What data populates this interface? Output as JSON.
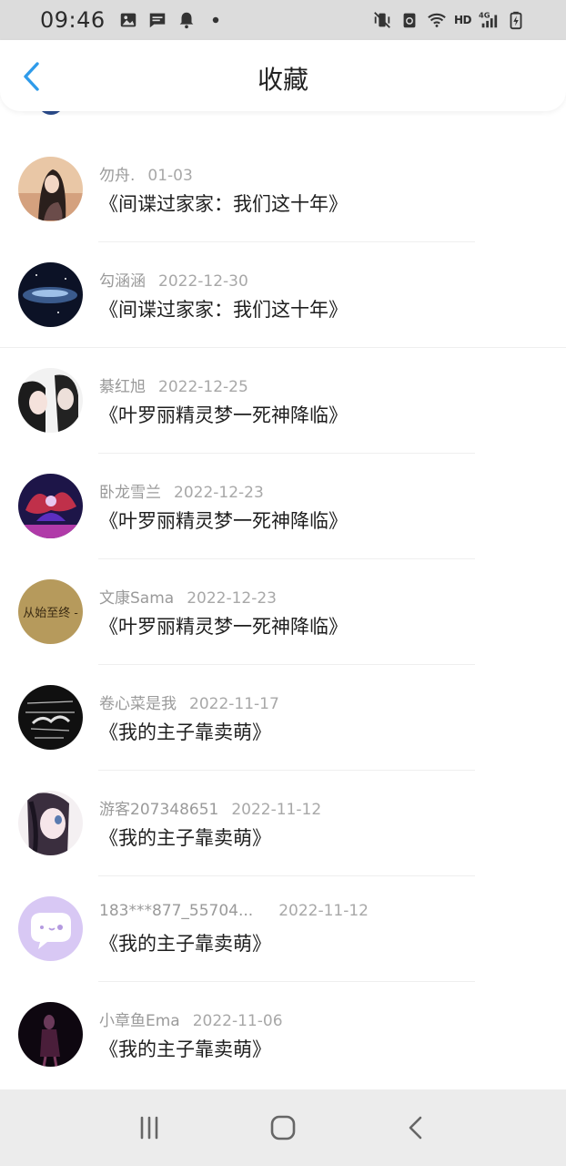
{
  "status_bar": {
    "time": "09:46",
    "network": "HD",
    "network_gen": "4G"
  },
  "header": {
    "title": "收藏",
    "back_icon": "chevron-left-icon"
  },
  "favorites": [
    {
      "user": "勿舟.",
      "date": "01-03",
      "book": "《间谍过家家：我们这十年》",
      "avatar_color": "#c9a58a"
    },
    {
      "user": "勾涵涵",
      "date": "2022-12-30",
      "book": "《间谍过家家：我们这十年》",
      "avatar_color": "#1d2a44"
    },
    {
      "user": "綦红旭",
      "date": "2022-12-25",
      "book": "《叶罗丽精灵梦一死神降临》",
      "avatar_color": "#d9d9d9"
    },
    {
      "user": "卧龙雪兰",
      "date": "2022-12-23",
      "book": "《叶罗丽精灵梦一死神降临》",
      "avatar_color": "#3a2a7a"
    },
    {
      "user": "文康Sama",
      "date": "2022-12-23",
      "book": "《叶罗丽精灵梦一死神降临》",
      "avatar_color": "#b89a5a",
      "avatar_text": "从始至终 -"
    },
    {
      "user": "卷心菜是我",
      "date": "2022-11-17",
      "book": "《我的主子靠卖萌》",
      "avatar_color": "#151515"
    },
    {
      "user": "游客207348651",
      "date": "2022-11-12",
      "book": "《我的主子靠卖萌》",
      "avatar_color": "#e8e2ea"
    },
    {
      "user": "183***877_55704...",
      "date": "2022-11-12",
      "book": "《我的主子靠卖萌》",
      "avatar_color": "#d6c4f2"
    },
    {
      "user": "小章鱼Ema",
      "date": "2022-11-06",
      "book": "《我的主子靠卖萌》",
      "avatar_color": "#1a0f1a"
    }
  ],
  "colors": {
    "accent": "#2f9bea",
    "status_bar_bg": "#dcdcdc",
    "nav_bar_bg": "#ececec"
  }
}
